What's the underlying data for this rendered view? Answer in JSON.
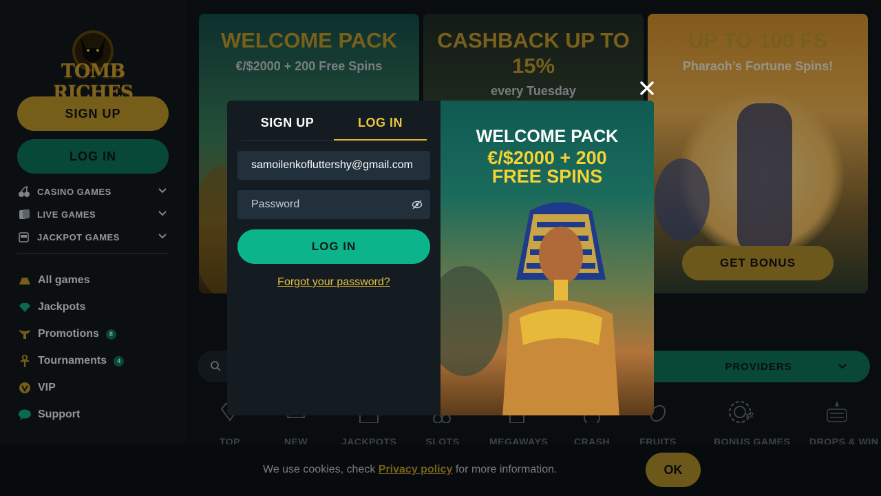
{
  "brand": {
    "name": "TOMB RICHES"
  },
  "sidebar": {
    "signup_label": "SIGN UP",
    "login_label": "LOG IN",
    "categories": [
      {
        "label": "CASINO GAMES",
        "icon": "cherries-icon"
      },
      {
        "label": "LIVE GAMES",
        "icon": "cards-icon"
      },
      {
        "label": "JACKPOT GAMES",
        "icon": "slot-machine-icon"
      }
    ],
    "nav": [
      {
        "label": "All games",
        "icon": "gold-bars-icon"
      },
      {
        "label": "Jackpots",
        "icon": "gem-icon"
      },
      {
        "label": "Promotions",
        "icon": "winged-scarab-icon",
        "badge": "8"
      },
      {
        "label": "Tournaments",
        "icon": "ankh-icon",
        "badge": "4"
      },
      {
        "label": "VIP",
        "icon": "vip-medal-icon"
      },
      {
        "label": "Support",
        "icon": "chat-icon"
      }
    ]
  },
  "banners": [
    {
      "title": "WELCOME PACK",
      "subtitle": "€/$2000 + 200 Free Spins"
    },
    {
      "title": "CASHBACK UP TO 15%",
      "subtitle": "every Tuesday"
    },
    {
      "title": "UP TO 100 FS",
      "subtitle": "Pharaoh’s Fortune Spins!",
      "button": "GET BONUS"
    }
  ],
  "filters": {
    "providers_label": "PROVIDERS"
  },
  "categories_row": [
    {
      "label": "TOP",
      "icon": "diamond-icon"
    },
    {
      "label": "NEW",
      "icon": "crown-icon"
    },
    {
      "label": "JACKPOTS",
      "icon": "win-icon"
    },
    {
      "label": "SLOTS",
      "icon": "cherries-icon"
    },
    {
      "label": "MEGAWAYS",
      "icon": "slot-machine-icon"
    },
    {
      "label": "CRASH",
      "icon": "rocket-icon"
    },
    {
      "label": "FRUITS",
      "icon": "lemon-icon"
    },
    {
      "label": "BONUS GAMES",
      "icon": "chip-x2-icon"
    },
    {
      "label": "DROPS & WIN",
      "icon": "drops-wins-icon"
    }
  ],
  "cookie": {
    "text_before": "We use cookies, check ",
    "link": "Privacy policy",
    "text_after": " for more information.",
    "ok_label": "OK"
  },
  "modal": {
    "tab_signup": "SIGN UP",
    "tab_login": "LOG IN",
    "active_tab": "LOG IN",
    "email_value": "samoilenkofluttershy@gmail.com",
    "password_placeholder": "Password",
    "login_button": "LOG IN",
    "forgot_link": "Forgot your password?",
    "promo_title": "WELCOME PACK",
    "promo_sub_line1": "€/$2000 + 200",
    "promo_sub_line2": "FREE SPINS"
  },
  "colors": {
    "gold": "#b48f29",
    "teal": "#0e6d55",
    "teal_bright": "#0bb48a",
    "link_yellow": "#e9c43c"
  }
}
